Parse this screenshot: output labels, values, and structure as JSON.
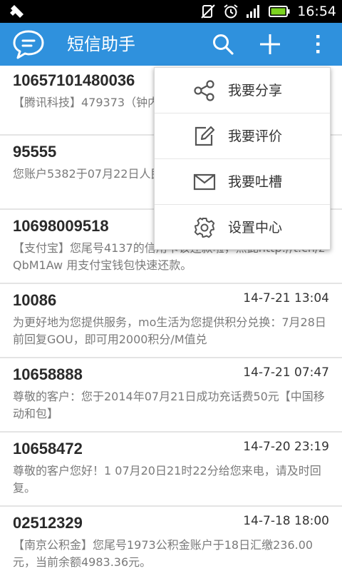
{
  "status_bar": {
    "time": "16:54"
  },
  "action_bar": {
    "title": "短信助手"
  },
  "menu": {
    "items": [
      {
        "label": "我要分享",
        "icon": "share-icon"
      },
      {
        "label": "我要评价",
        "icon": "edit-icon"
      },
      {
        "label": "我要吐槽",
        "icon": "mail-icon"
      },
      {
        "label": "设置中心",
        "icon": "gear-icon"
      }
    ]
  },
  "messages": [
    {
      "sender": "10657101480036",
      "date": "",
      "body": "【腾讯科技】479373（钟内有效）"
    },
    {
      "sender": "95555",
      "date": "",
      "body": "您账户5382于07月22日人民币0.01[招商银行]"
    },
    {
      "sender": "10698009518",
      "date": "",
      "body": "【支付宝】您尾号4137的信用卡该还款啦，点此http://t.cn/zQbM1Aw 用支付宝钱包快速还款。"
    },
    {
      "sender": "10086",
      "date": "14-7-21 13:04",
      "body": "为更好地为您提供服务，mo生活为您提供积分兑换：7月28日前回复GOU，即可用2000积分/M值兑"
    },
    {
      "sender": "10658888",
      "date": "14-7-21 07:47",
      "body": "尊敬的客户：您于2014年07月21日成功充话费50元【中国移动和包】"
    },
    {
      "sender": "10658472",
      "date": "14-7-20 23:19",
      "body": "尊敬的客户您好！1          07月20日21时22分给您来电，请及时回复。"
    },
    {
      "sender": "02512329",
      "date": "14-7-18 18:00",
      "body": "【南京公积金】您尾号1973公积金账户于18日汇缴236.00元，当前余额4983.36元。"
    }
  ]
}
